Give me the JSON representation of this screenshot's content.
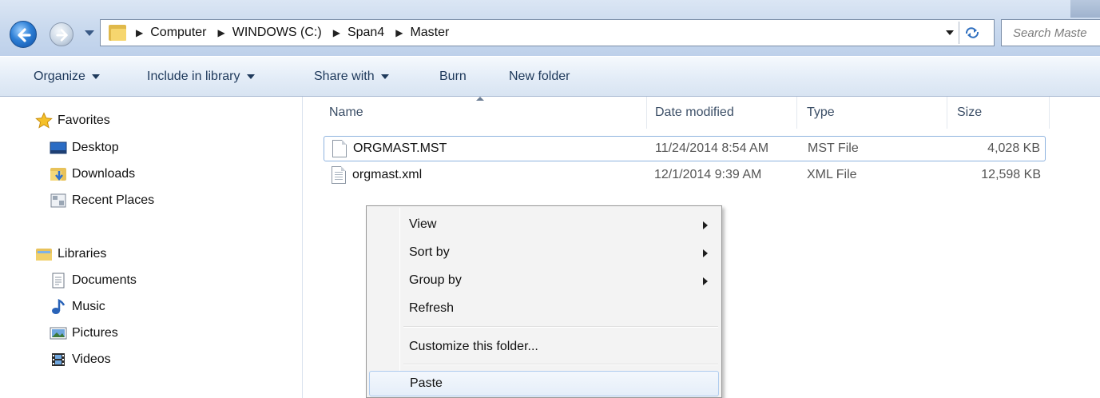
{
  "address": {
    "crumbs": [
      "Computer",
      "WINDOWS (C:)",
      "Span4",
      "Master"
    ],
    "search_placeholder": "Search Maste"
  },
  "toolbar": {
    "organize": "Organize",
    "include_in_library": "Include in library",
    "share_with": "Share with",
    "burn": "Burn",
    "new_folder": "New folder"
  },
  "nav": {
    "favorites": "Favorites",
    "favorites_items": [
      "Desktop",
      "Downloads",
      "Recent Places"
    ],
    "libraries": "Libraries",
    "libraries_items": [
      "Documents",
      "Music",
      "Pictures",
      "Videos"
    ]
  },
  "columns": {
    "name": "Name",
    "date_modified": "Date modified",
    "type": "Type",
    "size": "Size"
  },
  "files": [
    {
      "name": "ORGMAST.MST",
      "date": "11/24/2014 8:54 AM",
      "type": "MST File",
      "size": "4,028 KB",
      "selected": true
    },
    {
      "name": "orgmast.xml",
      "date": "12/1/2014 9:39 AM",
      "type": "XML File",
      "size": "12,598 KB",
      "selected": false
    }
  ],
  "context_menu": {
    "items": [
      "View",
      "Sort by",
      "Group by",
      "Refresh",
      "Customize this folder...",
      "Paste"
    ],
    "highlighted": "Paste"
  },
  "colors": {
    "toolbar_text": "#1e395b",
    "selection_border": "#8eb3df",
    "menu_hover_border": "#aecbee"
  }
}
